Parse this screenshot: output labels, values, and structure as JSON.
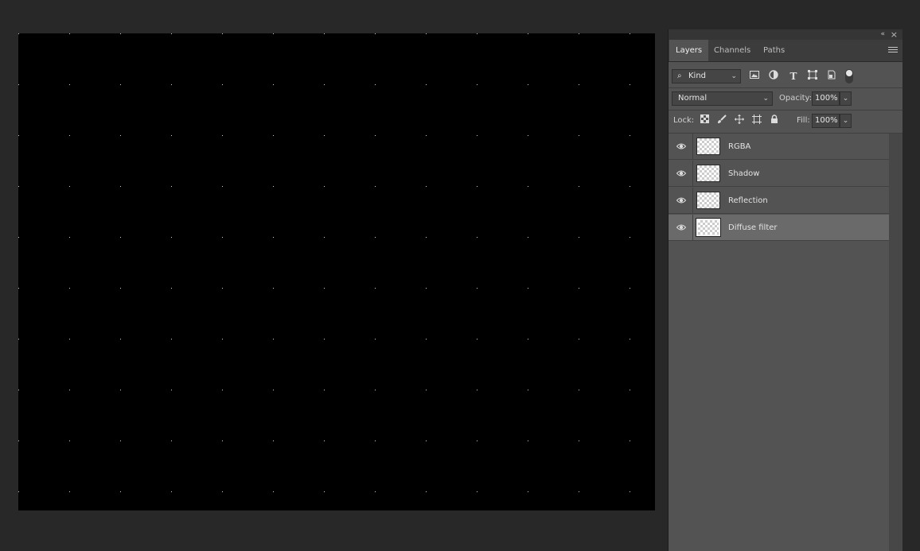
{
  "panel": {
    "topbar": {
      "collapse_glyph": "«",
      "close_glyph": "×"
    },
    "tabs": [
      {
        "label": "Layers",
        "active": true
      },
      {
        "label": "Channels",
        "active": false
      },
      {
        "label": "Paths",
        "active": false
      }
    ],
    "filter": {
      "kind_label": "Kind",
      "icons": [
        "image-filter-icon",
        "adjustment-filter-icon",
        "type-filter-icon",
        "shape-filter-icon",
        "smart-object-filter-icon",
        "filter-toggle-icon"
      ]
    },
    "blend": {
      "mode": "Normal",
      "opacity_label": "Opacity:",
      "opacity_value": "100%"
    },
    "lock": {
      "label": "Lock:",
      "icons": [
        "lock-transparent-icon",
        "lock-paint-icon",
        "lock-position-icon",
        "lock-artboard-icon",
        "lock-all-icon"
      ],
      "fill_label": "Fill:",
      "fill_value": "100%"
    },
    "layers": [
      {
        "name": "RGBA",
        "visible": true,
        "selected": false
      },
      {
        "name": "Shadow",
        "visible": true,
        "selected": false
      },
      {
        "name": "Reflection",
        "visible": true,
        "selected": false
      },
      {
        "name": "Diffuse filter",
        "visible": true,
        "selected": true
      }
    ]
  },
  "canvas": {
    "background": "#000000",
    "grid_color": "#cfcfcf"
  },
  "colors": {
    "app_bg": "#282828",
    "panel_bg": "#535353",
    "selected_layer": "#6a6a6a"
  }
}
